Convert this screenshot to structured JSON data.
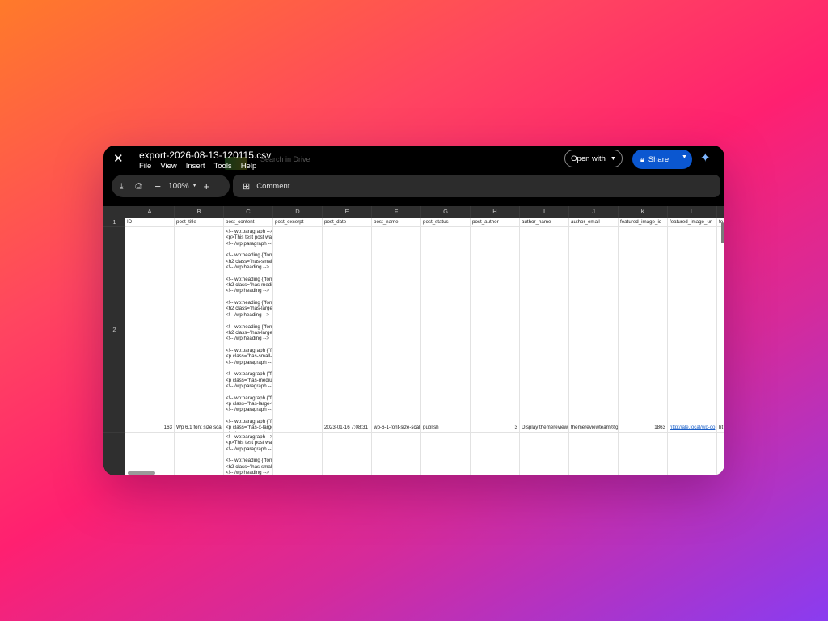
{
  "window": {
    "file_name": "export-2026-08-13-120115.csv",
    "ghost_text": "Search in Drive",
    "menu": [
      "File",
      "View",
      "Insert",
      "Tools",
      "Help"
    ],
    "open_with": "Open with",
    "share": "Share"
  },
  "toolbar": {
    "zoom": "100%",
    "comment": "Comment"
  },
  "columns": [
    "A",
    "B",
    "C",
    "D",
    "E",
    "F",
    "G",
    "H",
    "I",
    "J",
    "K",
    "L"
  ],
  "rows": [
    "1",
    "2"
  ],
  "header_row": [
    "ID",
    "post_title",
    "post_content",
    "post_excerpt",
    "post_date",
    "post_name",
    "post_status",
    "post_author",
    "author_name",
    "author_email",
    "featured_image_id",
    "featured_image_url",
    "fe"
  ],
  "row2": {
    "id": "163",
    "post_title": "Wp 6.1 font size scal",
    "post_content": "<!-- wp:paragraph -->\n<p>This test post was generated using the\n<!-- /wp:paragraph -->\n\n<!-- wp:heading {\"fontSize\":\"small\"} -->\n<h2 class=\"has-small-font-size\">Small H2\n<!-- /wp:heading -->\n\n<!-- wp:heading {\"fontSize\":\"medium\"} -->\n<h2 class=\"has-medium-font-size\">Mediu\n<!-- /wp:heading -->\n\n<!-- wp:heading {\"fontSize\":\"large\"} -->\n<h2 class=\"has-large-font-size\">Large H2 \n<!-- /wp:heading -->\n\n<!-- wp:heading {\"fontSize\":\"large\"} -->\n<h2 class=\"has-large-font-size\">Extra Larg\n<!-- /wp:heading -->\n\n<!-- wp:paragraph {\"fontSize\":\"small\"} -->\n<p class=\"has-small-font-size\">Small parag\n<!-- /wp:paragraph -->\n\n<!-- wp:paragraph {\"fontSize\":\"medium\"} --\n<p class=\"has-medium-font-size\">Medium \n<!-- /wp:paragraph -->\n\n<!-- wp:paragraph {\"fontSize\":\"large\"} -->\n<p class=\"has-large-font-size\">Large parag\n<!-- /wp:paragraph -->\n\n<!-- wp:paragraph {\"fontSize\":\"x-large\"} -->\n<p class=\"has-x-large-font-size\">Extra Larg\n<!-- /wp:paragraph -->",
    "post_date": "2023-01-16 7:08:31",
    "post_name": "wp-6-1-font-size-scal",
    "post_status": "publish",
    "post_author": "3",
    "author_name": "Display themereview",
    "author_email": "themereviewteam@g",
    "featured_image_id": "1863",
    "featured_image_url": "http://ale.local/wp-co",
    "extra": "ht"
  },
  "row3": {
    "post_content": "<!-- wp:paragraph -->\n<p>This test post was generated using the\n<!-- /wp:paragraph -->\n\n<!-- wp:heading {\"fontSize\":\"small\"} -->\n<h2 class=\"has-small-font-size\">Small H2 \n<!-- /wp:heading -->"
  }
}
